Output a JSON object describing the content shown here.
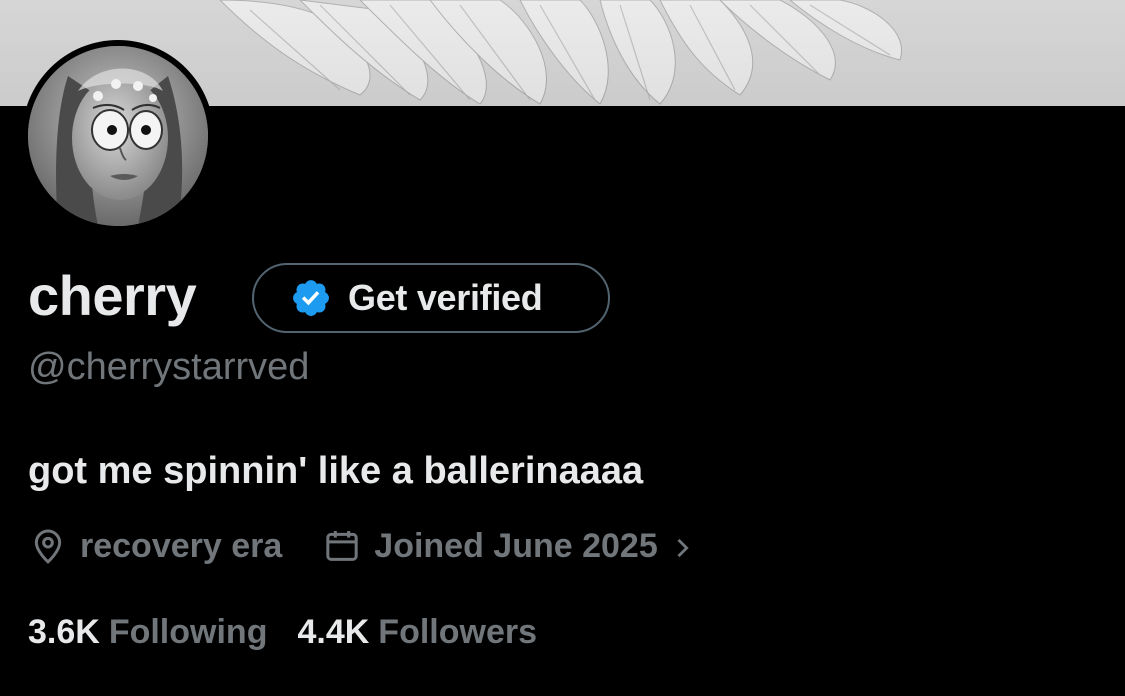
{
  "banner": {
    "icon": "angel-wings-image"
  },
  "avatar": {
    "icon": "avatar-image"
  },
  "profile": {
    "display_name": "cherry",
    "handle": "@cherrystarrved",
    "bio": "got me spinnin' like a ballerinaaaa"
  },
  "verify": {
    "label": "Get verified",
    "badge_color": "#1d9bf0",
    "icon": "verified-badge-icon"
  },
  "meta": {
    "location": "recovery era",
    "location_icon": "location-pin-icon",
    "joined": "Joined June 2025",
    "joined_icon": "calendar-icon",
    "chevron_icon": "chevron-right-icon"
  },
  "stats": {
    "following_count": "3.6K",
    "following_label": "Following",
    "followers_count": "4.4K",
    "followers_label": "Followers"
  },
  "colors": {
    "background": "#000000",
    "primary_text": "#e7e9ea",
    "secondary_text": "#71767b",
    "border": "#536471"
  }
}
